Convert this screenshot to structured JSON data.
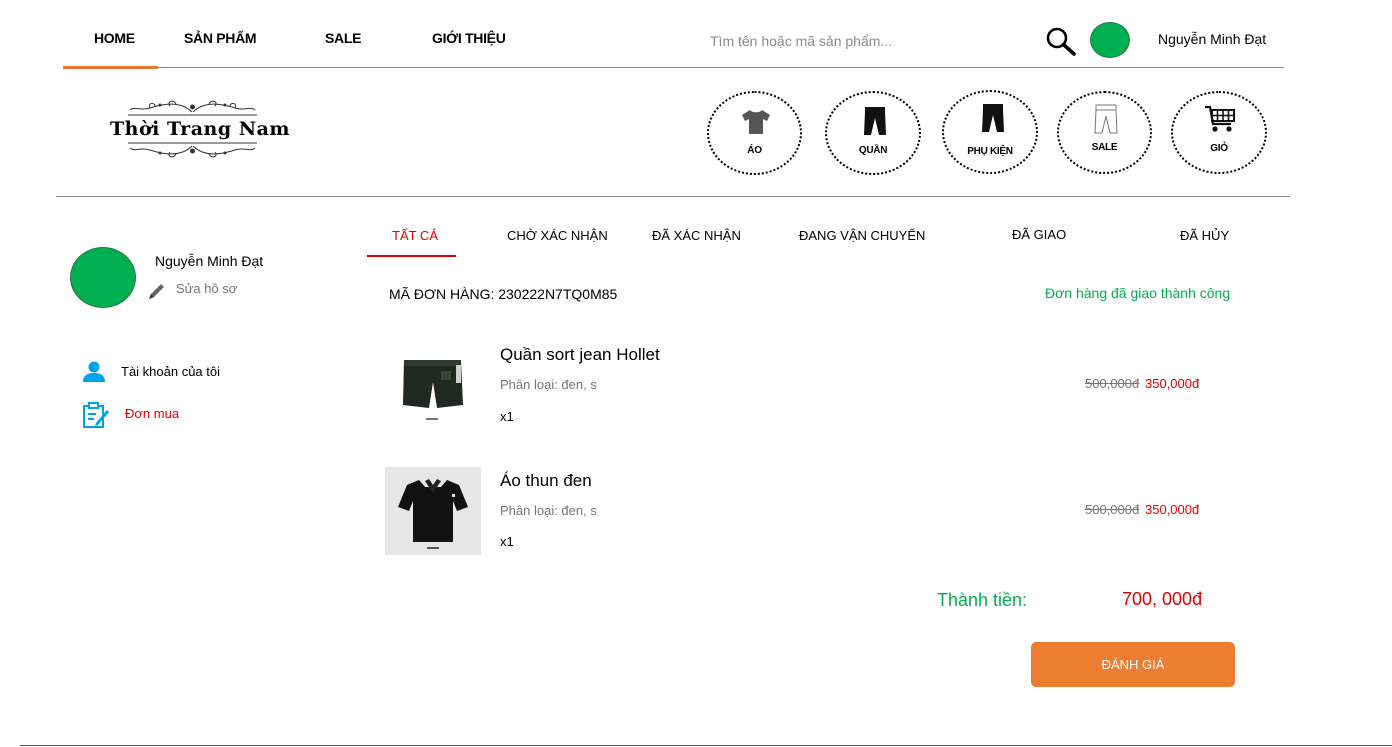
{
  "nav": {
    "home": "HOME",
    "products": "SẢN PHẨM",
    "sale": "SALE",
    "about": "GIỚI THIỆU",
    "search_placeholder": "Tìm tên hoặc mã sản phẩm...",
    "user_name": "Nguyễn Minh Đạt"
  },
  "logo": {
    "text": "Thời Trang Nam"
  },
  "categories": [
    {
      "label": "ÁO",
      "icon": "shirt-icon"
    },
    {
      "label": "QUẦN",
      "icon": "pants-icon"
    },
    {
      "label": "PHỤ KIỆN",
      "icon": "pants-icon"
    },
    {
      "label": "SALE",
      "icon": "pants-outline-icon"
    },
    {
      "label": "GIỎ",
      "icon": "cart-icon"
    }
  ],
  "sidebar": {
    "user_name": "Nguyễn Minh Đạt",
    "edit_profile": "Sửa hồ sơ",
    "items": [
      {
        "label": "Tài khoản của tôi",
        "icon": "user-icon"
      },
      {
        "label": "Đơn mua",
        "icon": "order-icon",
        "active": true
      }
    ]
  },
  "tabs": [
    {
      "label": "TẤT CẢ",
      "active": true
    },
    {
      "label": "CHỜ XÁC NHẬN"
    },
    {
      "label": "ĐÃ XÁC NHẬN"
    },
    {
      "label": "ĐANG VẬN CHUYỂN"
    },
    {
      "label": "ĐÃ GIAO"
    },
    {
      "label": "ĐÃ HỦY"
    }
  ],
  "order": {
    "id_text": "MÃ ĐƠN HÀNG: 230222N7TQ0M85",
    "status": "Đơn hàng đã giao thành công",
    "items": [
      {
        "name": "Quần sort jean Hollet",
        "variant": "Phân loại: đen, s",
        "qty": "x1",
        "price_old": "500,000đ",
        "price_new": "350,000đ",
        "image": "jean-shorts-image"
      },
      {
        "name": "Áo thun đen",
        "variant": "Phân loại: đen, s",
        "qty": "x1",
        "price_old": "500,000đ",
        "price_new": "350,000đ",
        "image": "black-polo-image"
      }
    ],
    "total_label": "Thành tiền:",
    "total_value": "700, 000đ",
    "rate_button": "ĐÁNH GIÁ"
  },
  "colors": {
    "accent": "#ED7D31",
    "green": "#00B050",
    "red": "#E00000",
    "icon_blue": "#00A3E8"
  }
}
